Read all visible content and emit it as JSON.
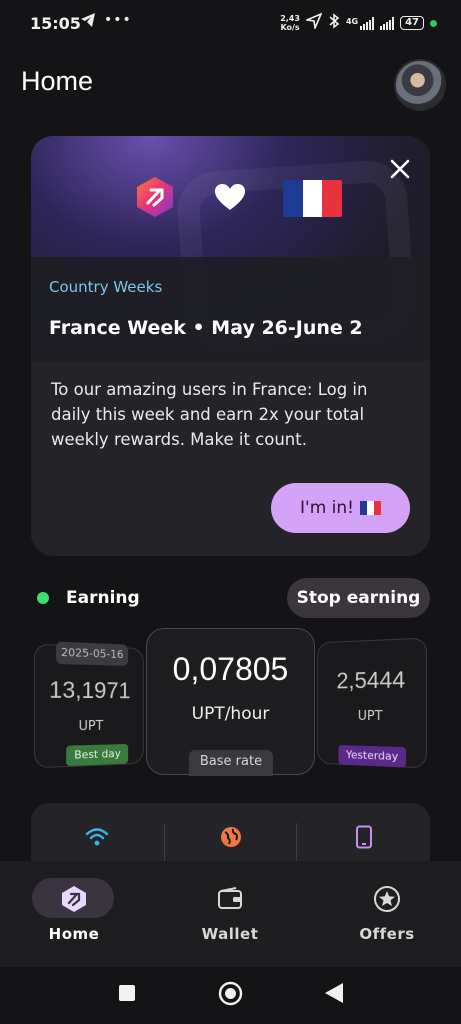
{
  "status_bar": {
    "time": "15:05",
    "speed_value": "2,43",
    "speed_unit": "Ko/s",
    "network_type": "4G",
    "battery": "47"
  },
  "header": {
    "title": "Home"
  },
  "promo": {
    "tag": "Country Weeks",
    "title": "France Week • May 26-June 2",
    "body": "To our amazing users in France: Log in daily this week and earn 2x your total weekly rewards. Make it count.",
    "cta_label": "I'm in!",
    "colors": {
      "tag": "#7ac8e8",
      "cta_bg": "#d4a3f7",
      "flag_blue": "#1f3a93",
      "flag_white": "#ffffff",
      "flag_red": "#e8323c"
    }
  },
  "earning": {
    "status_label": "Earning",
    "status_color": "#3cde6e",
    "stop_label": "Stop earning"
  },
  "stats": {
    "left": {
      "date": "2025-05-16",
      "value": "13,1971",
      "unit": "UPT",
      "badge": "Best day"
    },
    "center": {
      "value": "0,07805",
      "unit": "UPT/hour",
      "badge": "Base rate"
    },
    "right": {
      "value": "2,5444",
      "unit": "UPT",
      "badge": "Yesterday"
    }
  },
  "network_icons": [
    "wifi-icon",
    "globe-icon",
    "phone-icon"
  ],
  "nav": {
    "items": [
      {
        "label": "Home",
        "icon": "brand-logo-icon",
        "active": true
      },
      {
        "label": "Wallet",
        "icon": "wallet-icon",
        "active": false
      },
      {
        "label": "Offers",
        "icon": "star-circle-icon",
        "active": false
      }
    ]
  }
}
